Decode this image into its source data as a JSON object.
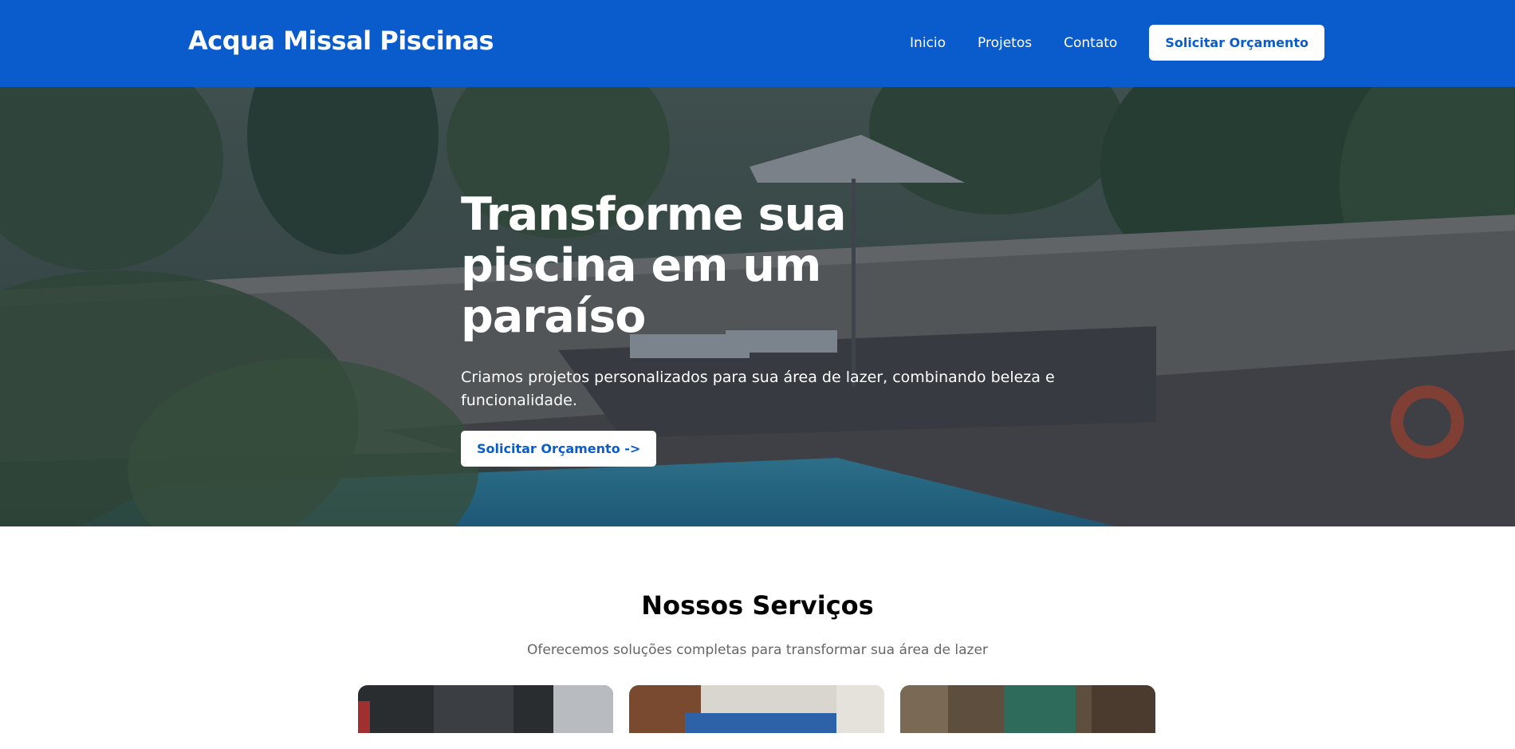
{
  "header": {
    "brand": "Acqua Missal Piscinas",
    "nav": [
      "Inicio",
      "Projetos",
      "Contato"
    ],
    "cta_label": "Solicitar Orçamento"
  },
  "hero": {
    "title": "Transforme sua piscina em um paraíso",
    "subtitle": "Criamos projetos personalizados para sua área de lazer, combinando beleza e funcionalidade.",
    "cta_label": "Solicitar Orçamento ->"
  },
  "services": {
    "title": "Nossos Serviços",
    "subtitle": "Oferecemos soluções completas para transformar sua área de lazer"
  },
  "colors": {
    "brand_blue": "#0a5ccc",
    "white": "#ffffff"
  },
  "icons": []
}
